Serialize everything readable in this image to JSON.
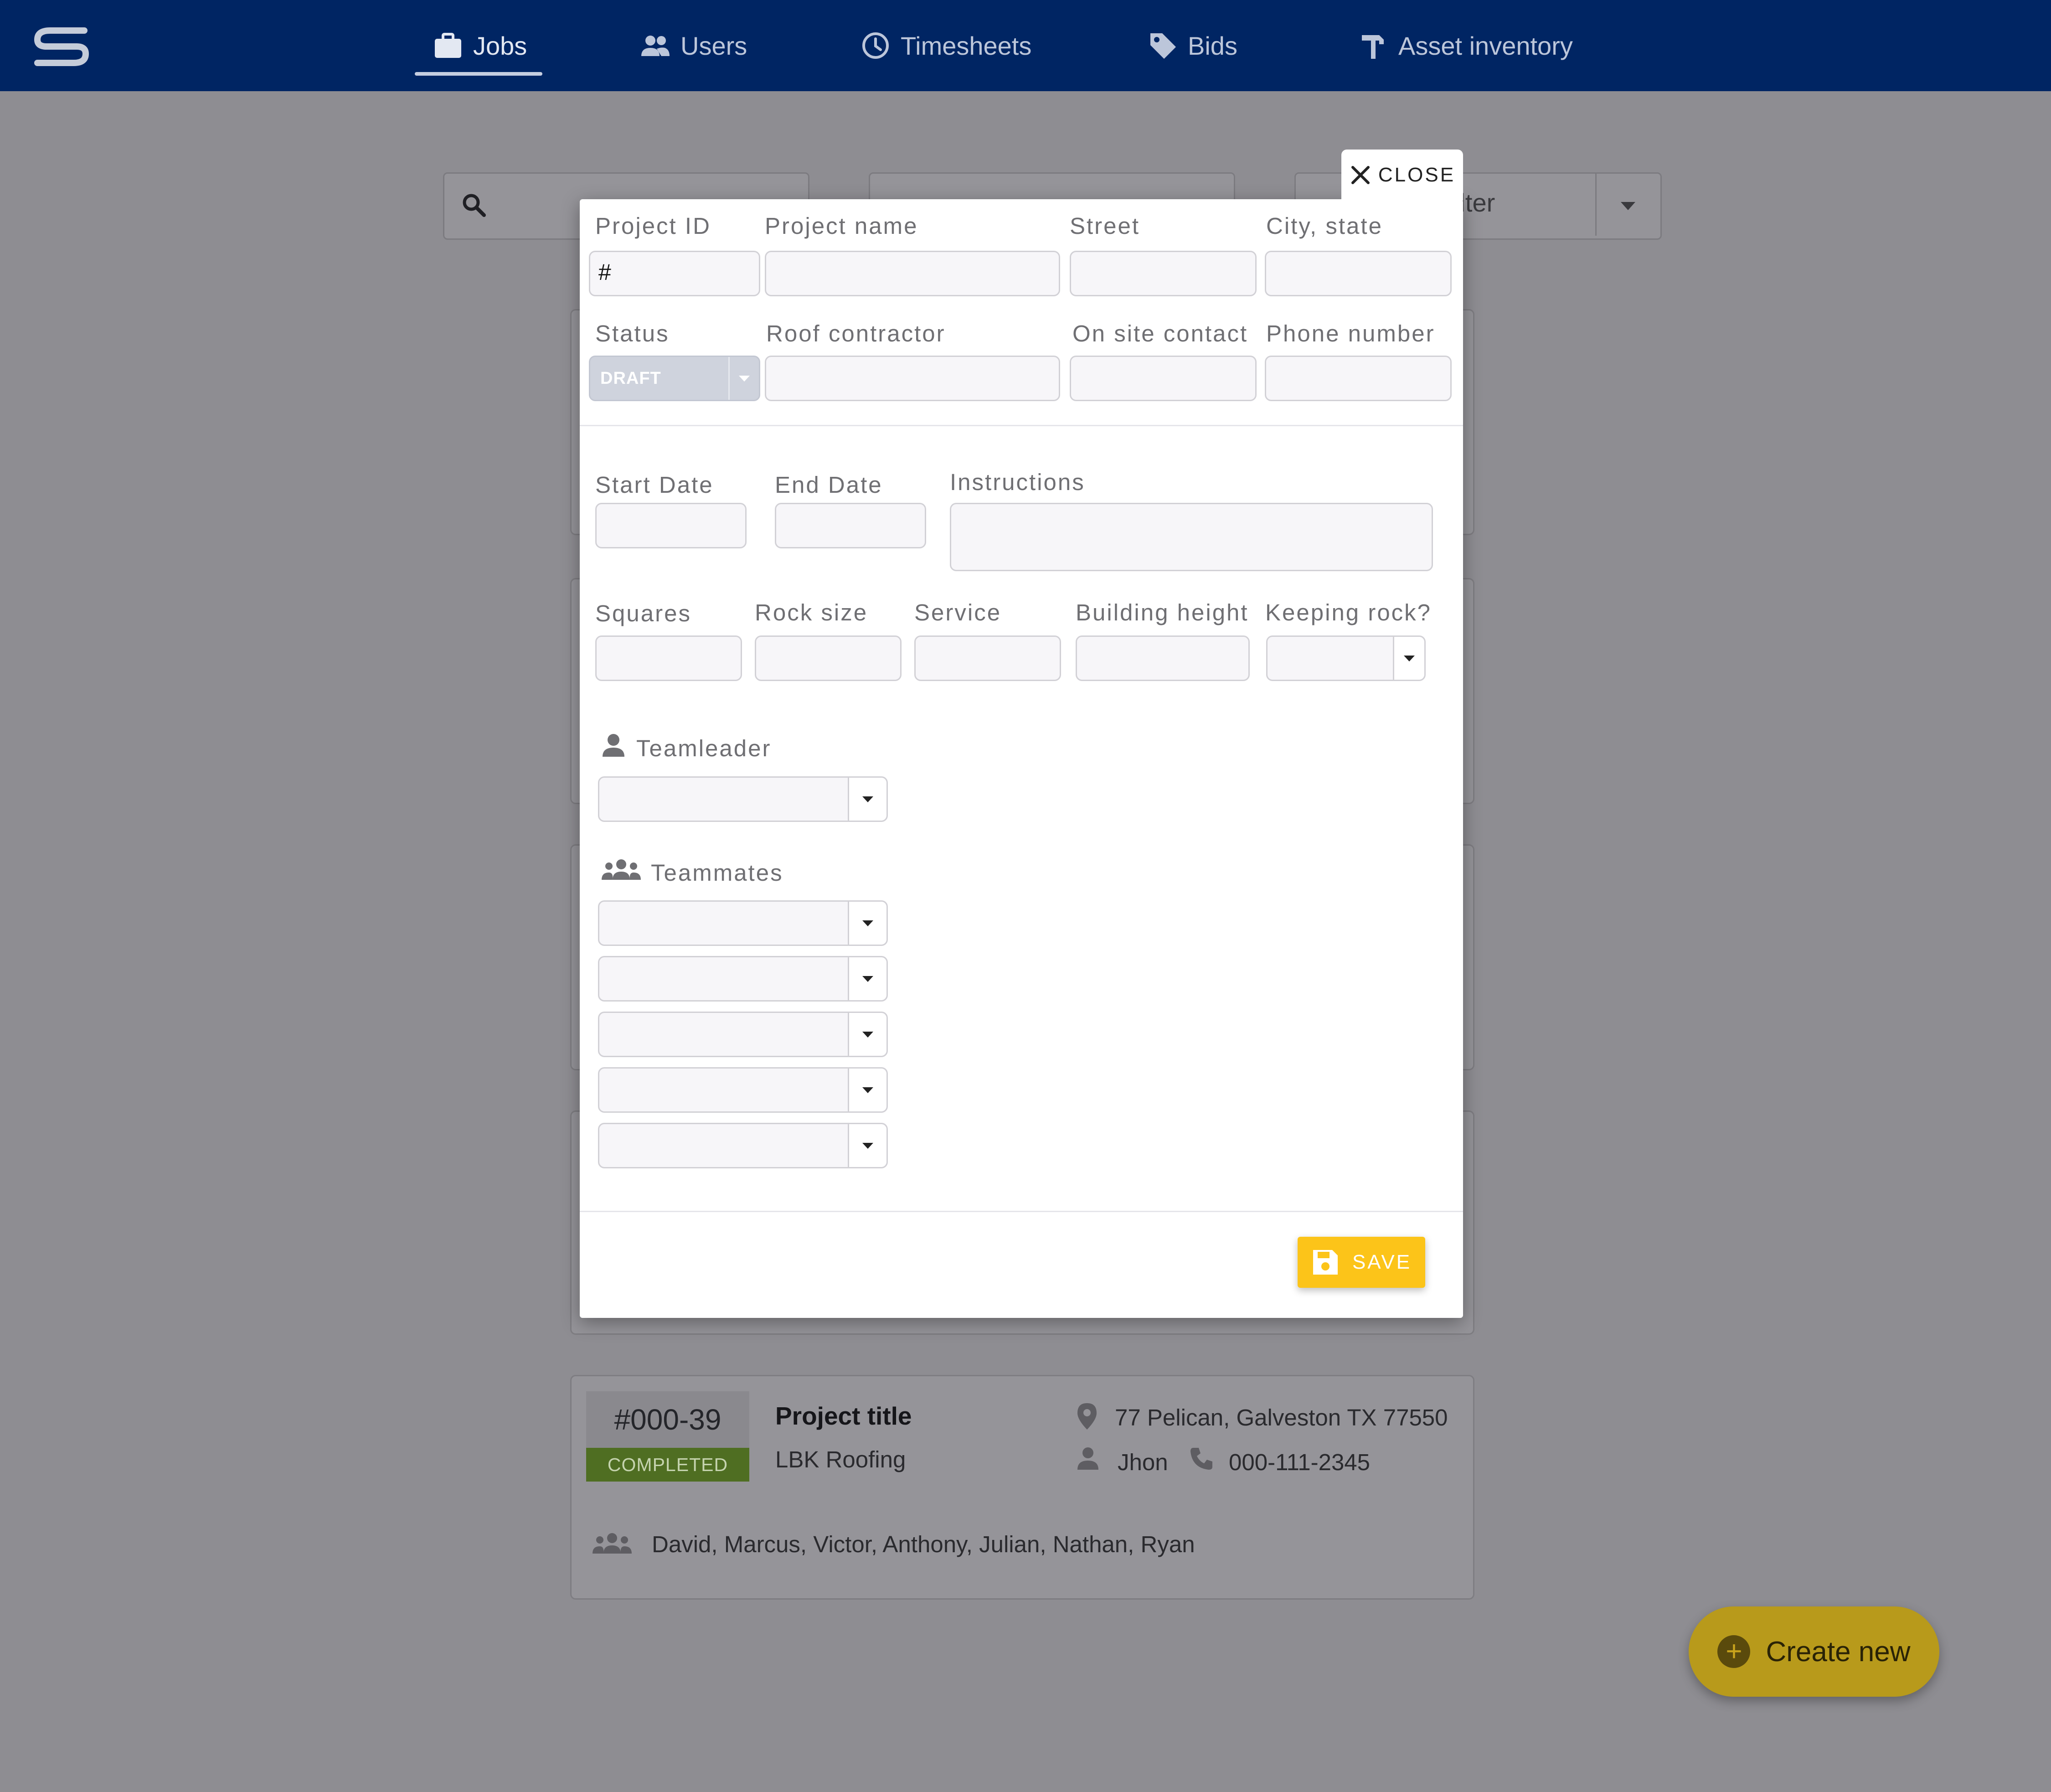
{
  "nav": {
    "items": [
      {
        "label": "Jobs",
        "icon": "briefcase-icon",
        "active": true
      },
      {
        "label": "Users",
        "icon": "users-icon"
      },
      {
        "label": "Timesheets",
        "icon": "clock-icon"
      },
      {
        "label": "Bids",
        "icon": "tag-icon"
      },
      {
        "label": "Asset inventory",
        "icon": "hammer-icon"
      }
    ]
  },
  "toolbar": {
    "filter_partial": "ilter"
  },
  "modal": {
    "close_label": "CLOSE",
    "labels": {
      "project_id": "Project ID",
      "project_name": "Project name",
      "street": "Street",
      "city_state": "City, state",
      "status": "Status",
      "roof_contractor": "Roof contractor",
      "on_site_contact": "On site contact",
      "phone_number": "Phone number",
      "start_date": "Start Date",
      "end_date": "End Date",
      "instructions": "Instructions",
      "squares": "Squares",
      "rock_size": "Rock size",
      "service": "Service",
      "building_height": "Building height",
      "keeping_rock": "Keeping rock?",
      "teamleader": "Teamleader",
      "teammates": "Teammates"
    },
    "values": {
      "project_id": "#",
      "status": "DRAFT"
    },
    "save_label": "SAVE"
  },
  "job": {
    "id": "#000-39",
    "status": "COMPLETED",
    "title": "Project title",
    "contractor": "LBK Roofing",
    "address": "77 Pelican, Galveston TX 77550",
    "contact": "Jhon",
    "phone": "000-111-2345",
    "team": "David, Marcus, Victor, Anthony, Julian, Nathan, Ryan"
  },
  "fab": {
    "label": "Create new"
  },
  "colors": {
    "topbar": "#002563",
    "save": "#fcc419",
    "completed": "#4f6e22"
  }
}
